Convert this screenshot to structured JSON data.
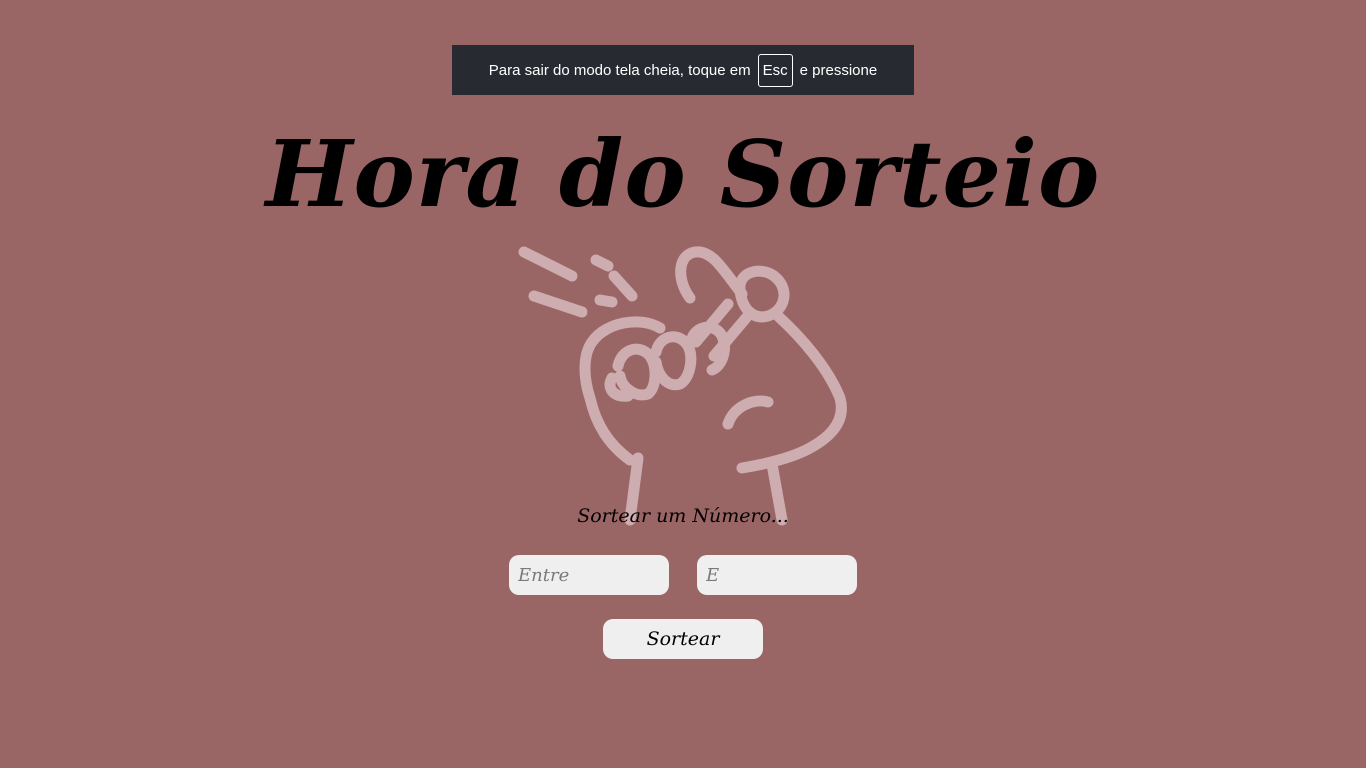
{
  "fullscreen_notice": {
    "text_before": "Para sair do modo tela cheia, toque em",
    "key_label": "Esc",
    "text_after": "e pressione"
  },
  "title": "Hora do Sorteio",
  "illustration": {
    "icon": "snapping-fingers-hand-icon",
    "color": "#cdadb0"
  },
  "subtitle": "Sortear um Número...",
  "inputs": {
    "from_placeholder": "Entre",
    "to_placeholder": "E"
  },
  "draw_button_label": "Sortear",
  "colors": {
    "background": "#9a6665",
    "toast": "#272a30",
    "field": "#efefef",
    "illustration": "#cdadb0"
  }
}
